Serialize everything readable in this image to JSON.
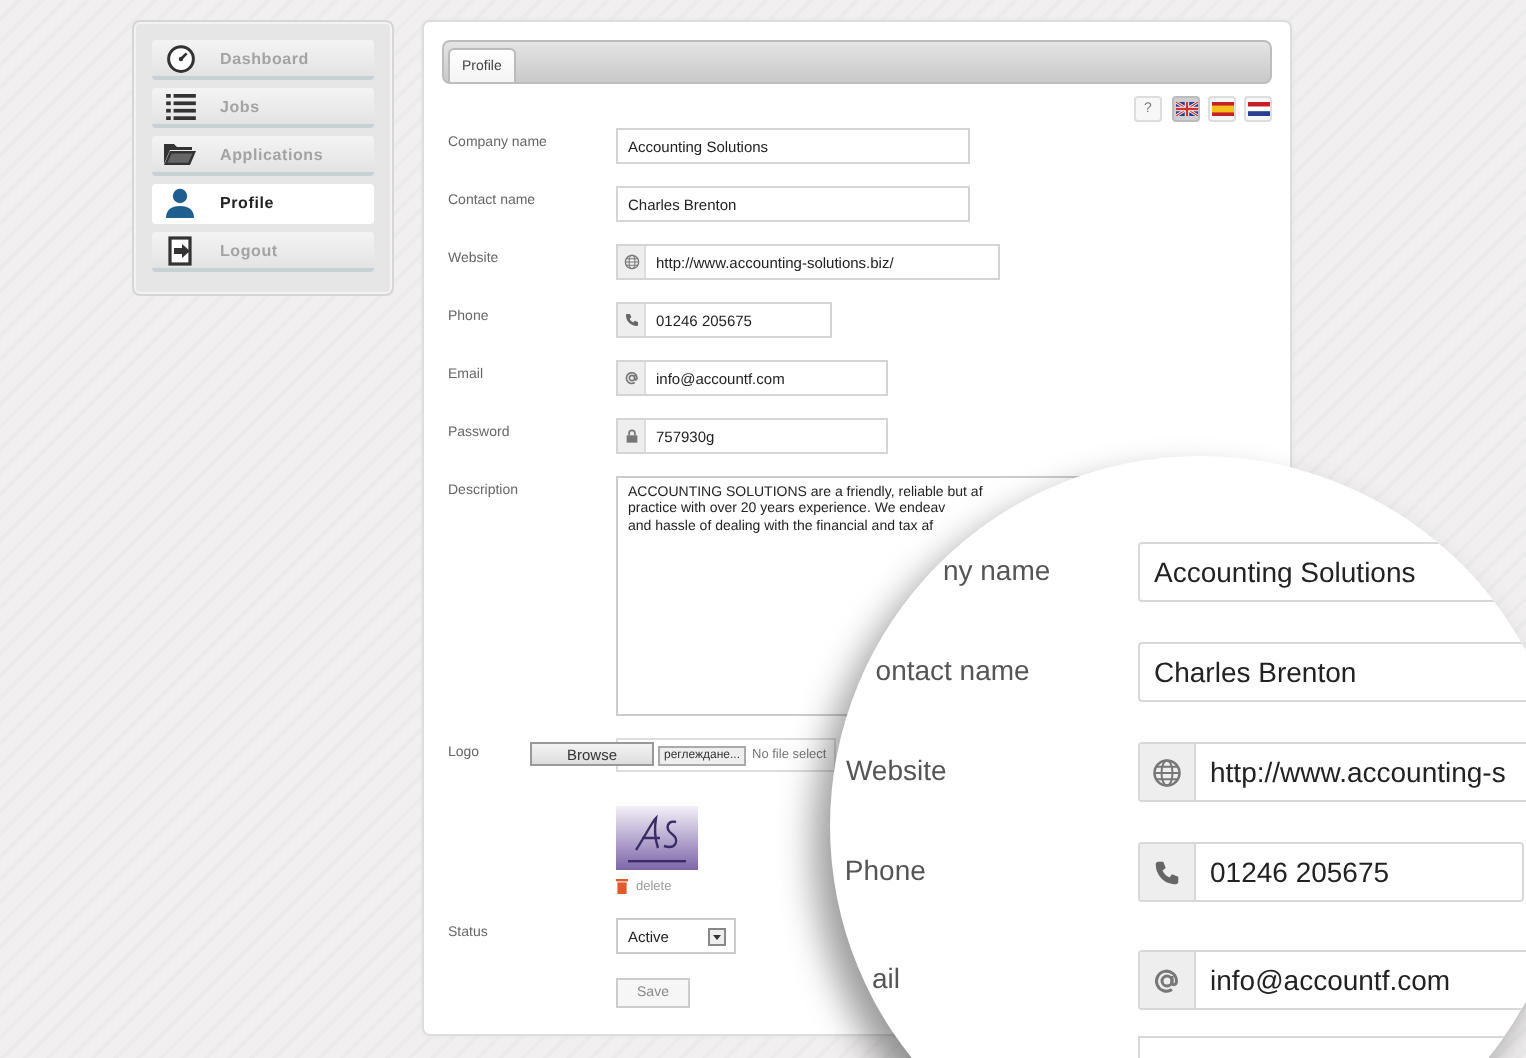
{
  "sidebar": {
    "items": [
      {
        "label": "Dashboard",
        "kind": "gauge",
        "selected": false
      },
      {
        "label": "Jobs",
        "kind": "list",
        "selected": false
      },
      {
        "label": "Applications",
        "kind": "folder",
        "selected": false
      },
      {
        "label": "Profile",
        "kind": "person",
        "selected": true
      },
      {
        "label": "Logout",
        "kind": "exit",
        "selected": false
      }
    ]
  },
  "panel": {
    "tabs": [
      {
        "label": "Profile",
        "selected": true
      }
    ],
    "help": "?",
    "languages": [
      {
        "kind": "uk",
        "selected": true
      },
      {
        "kind": "es",
        "selected": false
      },
      {
        "kind": "nl",
        "selected": false
      }
    ],
    "fields": [
      {
        "label": "Company name",
        "value": "Accounting Solutions",
        "kind": "text"
      },
      {
        "label": "Contact name",
        "value": "Charles Brenton",
        "kind": "text"
      },
      {
        "label": "Website",
        "value": "http://www.accounting-solutions.biz/",
        "kind": "web"
      },
      {
        "label": "Phone",
        "value": "01246 205675",
        "kind": "phone"
      },
      {
        "label": "Email",
        "value": "info@accountf.com",
        "kind": "email"
      },
      {
        "label": "Password",
        "value": "757930g",
        "kind": "password"
      }
    ],
    "description": {
      "label": "Description",
      "lines": [
        "ACCOUNTING SOLUTIONS are a friendly, reliable but af",
        "practice with over 20 years experience. We endeav",
        "and hassle of dealing with the financial and tax af"
      ]
    },
    "logo": {
      "label": "Logo",
      "browse": "Browse",
      "file_button": "реглеждане...",
      "file_status": "No file select",
      "delete": "delete"
    },
    "status": {
      "label": "Status",
      "value": "Active"
    },
    "save": "Save"
  },
  "magnifier": {
    "rows": [
      {
        "label": "ny name",
        "value": "Accounting Solutions",
        "kind": "text"
      },
      {
        "label": "ontact name",
        "value": "Charles Brenton",
        "kind": "text"
      },
      {
        "label": "Website",
        "value": "http://www.accounting-s",
        "kind": "web"
      },
      {
        "label": "Phone",
        "value": "01246 205675",
        "kind": "phone"
      },
      {
        "label": "ail",
        "value": "info@accountf.com",
        "kind": "email"
      }
    ]
  }
}
